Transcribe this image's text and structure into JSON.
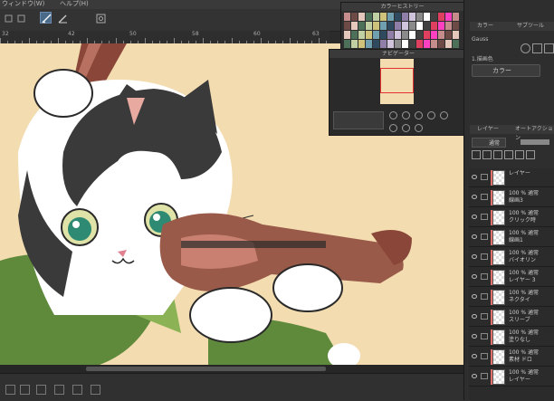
{
  "menu": {
    "items": [
      "ウィンドウ(W)",
      "ヘルプ(H)"
    ]
  },
  "toolbar": {
    "buttons": [
      "square-icon",
      "select-icon",
      "pen-tool-icon",
      "blend-icon",
      "settings-icon"
    ]
  },
  "ruler": {
    "labels": [
      "32",
      "42",
      "50",
      "58",
      "60",
      "63"
    ]
  },
  "color_history": {
    "title": "カラーヒストリー"
  },
  "navigator": {
    "title": "ナビゲーター"
  },
  "right_panel": {
    "top_tabs": [
      "カラー",
      "サブツール"
    ],
    "mode_label": "Gauss",
    "section_label": "1.描画色",
    "color_select": "カラー"
  },
  "layer_panel": {
    "tabs": [
      "レイヤー",
      "オートアクション"
    ],
    "blend_mode": "通常",
    "layers": [
      "レイヤー",
      "100 % 通常\n線画3",
      "100 % 通常\nクリック時",
      "100 % 通常\n線画1",
      "100 % 通常\nバイオリン",
      "100 % 通常\nレイヤー 3",
      "100 % 通常\nネクタイ",
      "100 % 通常\nスリーブ",
      "100 % 通常\n塗りなし",
      "100 % 通常\n素材 ドロ",
      "100 % 通常\nレイヤー"
    ]
  },
  "colors": {
    "background": "#f3dcb0",
    "panel": "#2e2e2e",
    "accent": "#4a6a8a",
    "layer_mark": "#e0706a"
  }
}
